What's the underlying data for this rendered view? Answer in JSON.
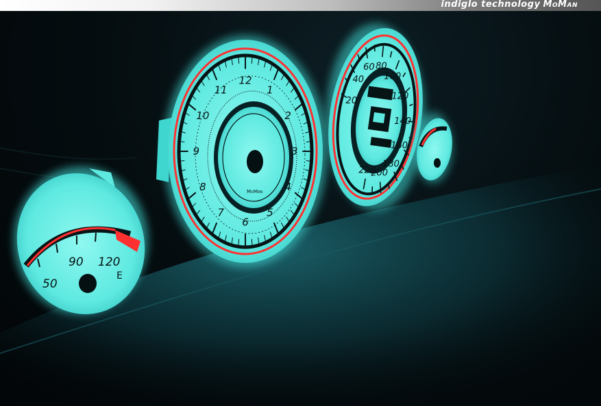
{
  "banner": {
    "text": "indiglo technology",
    "brand": "MoMan"
  },
  "tachometer": {
    "labels": [
      "12",
      "1",
      "2",
      "3",
      "4",
      "5",
      "6",
      "7",
      "8",
      "9",
      "10",
      "11"
    ],
    "logo": "MoMan"
  },
  "speedometer": {
    "labels": [
      "20",
      "40",
      "60",
      "80",
      "100",
      "120",
      "140",
      "160",
      "180",
      "200",
      "220"
    ]
  },
  "temperature_gauge": {
    "labels": [
      "50",
      "90",
      "120"
    ],
    "symbol": "E"
  },
  "colors": {
    "glow": "#6ff2e8",
    "glow_dark": "#27c4c0",
    "redline": "#ff3030",
    "ink": "#061416"
  }
}
